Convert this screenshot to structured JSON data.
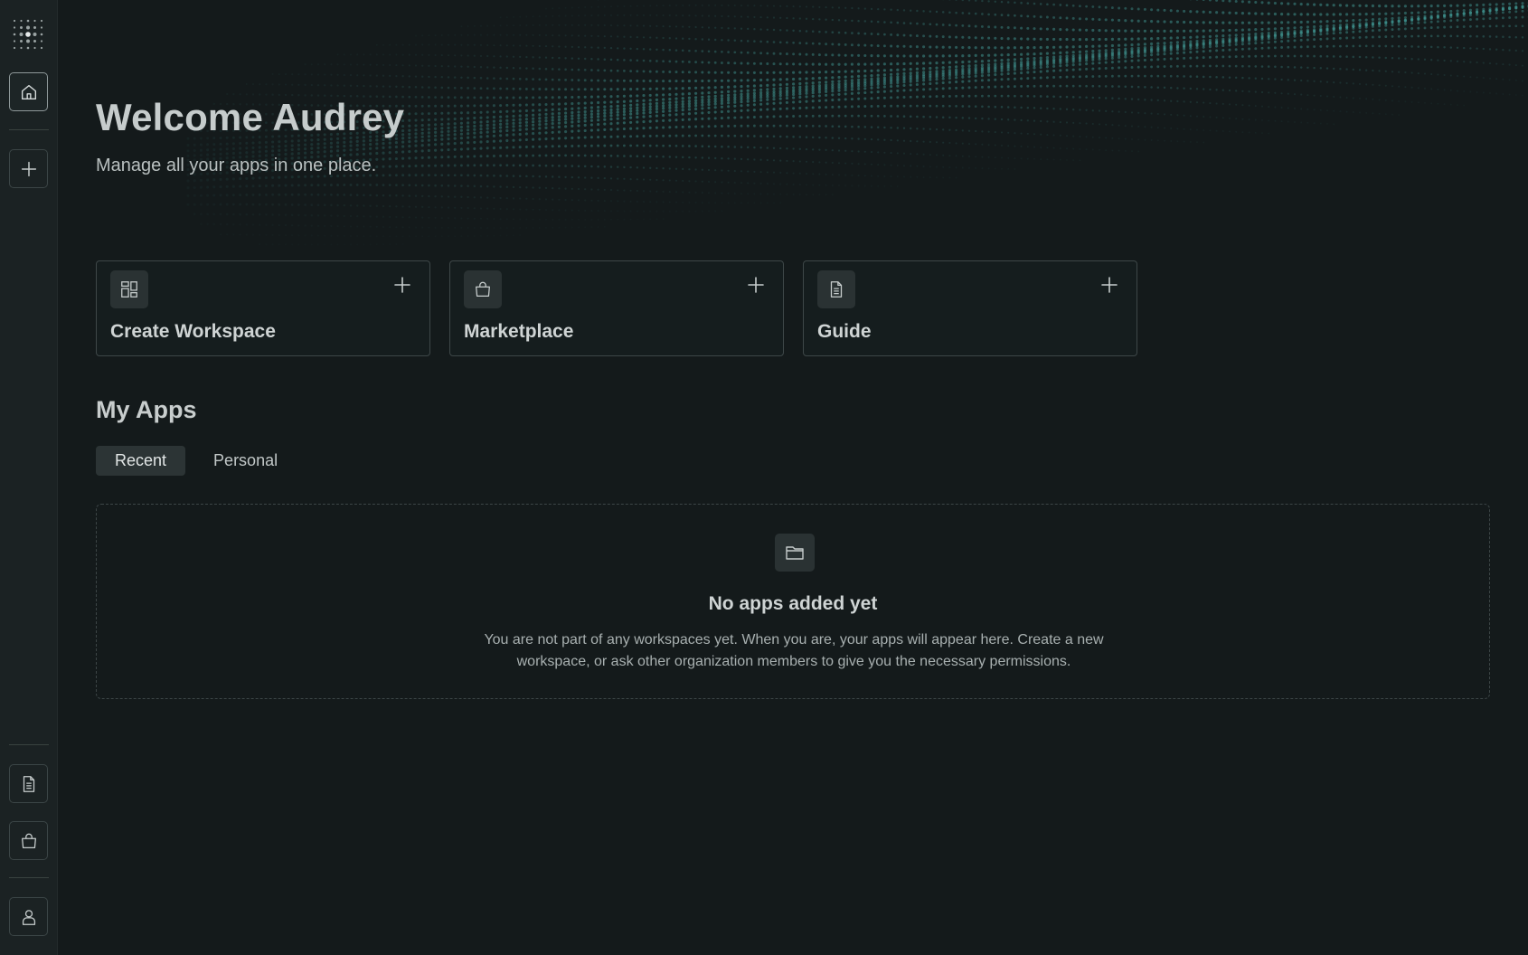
{
  "sidebar": {
    "logo_icon": "dots-grid-logo-icon",
    "top_items": [
      {
        "id": "home",
        "icon": "home-icon",
        "active": true
      },
      {
        "id": "add",
        "icon": "plus-icon",
        "active": false
      }
    ],
    "bottom_items": [
      {
        "id": "guide",
        "icon": "document-icon"
      },
      {
        "id": "marketplace",
        "icon": "shopping-bag-icon"
      },
      {
        "id": "profile",
        "icon": "user-icon"
      }
    ]
  },
  "header": {
    "title": "Welcome Audrey",
    "subtitle": "Manage all your apps in one place."
  },
  "cards": [
    {
      "label": "Create Workspace",
      "icon": "layout-grid-icon"
    },
    {
      "label": "Marketplace",
      "icon": "shopping-bag-icon"
    },
    {
      "label": "Guide",
      "icon": "document-icon"
    }
  ],
  "my_apps": {
    "title": "My Apps",
    "tabs": [
      {
        "label": "Recent",
        "active": true
      },
      {
        "label": "Personal",
        "active": false
      }
    ],
    "empty_state": {
      "icon": "folder-icon",
      "title": "No apps added yet",
      "description": "You are not part of any workspaces yet. When you are, your apps will appear here. Create a new workspace, or ask other organization members to give you the necessary permissions."
    }
  },
  "colors": {
    "background": "#141a1b",
    "sidebar": "#1b2223",
    "accent_teal": "#3c8a86",
    "border": "#3e4748"
  }
}
